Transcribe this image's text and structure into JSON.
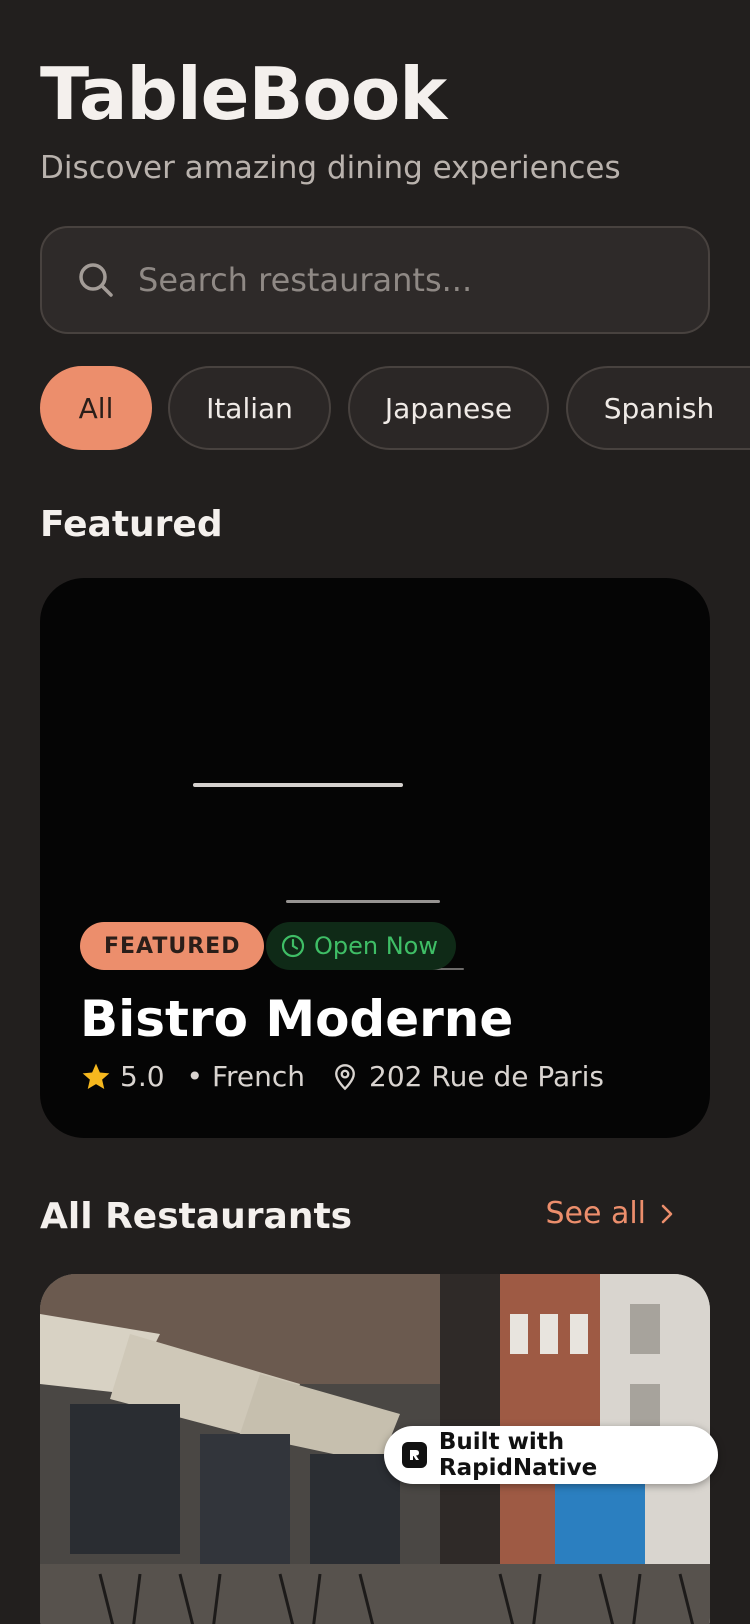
{
  "header": {
    "title": "TableBook",
    "subtitle": "Discover amazing dining experiences"
  },
  "search": {
    "placeholder": "Search restaurants...",
    "value": "",
    "icon": "search-icon"
  },
  "categories": [
    {
      "label": "All",
      "active": true
    },
    {
      "label": "Italian",
      "active": false
    },
    {
      "label": "Japanese",
      "active": false
    },
    {
      "label": "Spanish",
      "active": false
    }
  ],
  "featured": {
    "section_title": "Featured",
    "badge": "FEATURED",
    "status": "Open Now",
    "name": "Bistro Moderne",
    "rating": "5.0",
    "cuisine": "• French",
    "address": "202 Rue de Paris"
  },
  "all_restaurants": {
    "section_title": "All Restaurants",
    "see_all": "See all"
  },
  "watermark": {
    "label": "Built with RapidNative"
  },
  "colors": {
    "background": "#221f1e",
    "accent": "#ec8e6c",
    "open_green": "#3fbe66",
    "star": "#f6b81e"
  }
}
